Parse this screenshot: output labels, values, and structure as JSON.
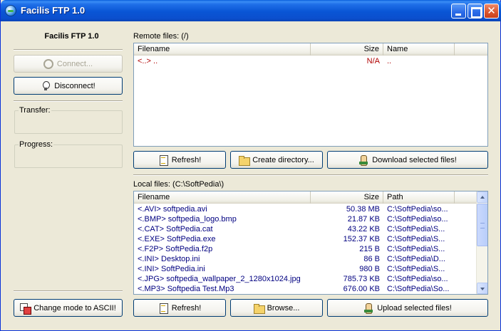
{
  "window": {
    "title": "Facilis FTP 1.0"
  },
  "sidebar": {
    "app_label": "Facilis FTP 1.0",
    "connect_label": "Connect...",
    "disconnect_label": "Disconnect!",
    "transfer_label": "Transfer:",
    "progress_label": "Progress:",
    "change_mode_label": "Change mode to ASCII!"
  },
  "remote": {
    "label": "Remote files: (/)",
    "columns": [
      "Filename",
      "Size",
      "Name"
    ],
    "rows": [
      {
        "filename": "<..> ..",
        "size": "N/A",
        "name": ".."
      }
    ],
    "refresh_label": "Refresh!",
    "create_dir_label": "Create directory...",
    "download_label": "Download selected files!"
  },
  "local": {
    "label": "Local files: (C:\\SoftPedia\\)",
    "columns": [
      "Filename",
      "Size",
      "Path"
    ],
    "rows": [
      {
        "filename": "<.AVI> softpedia.avi",
        "size": "50.38 MB",
        "path": "C:\\SoftPedia\\so..."
      },
      {
        "filename": "<.BMP> softpedia_logo.bmp",
        "size": "21.87 KB",
        "path": "C:\\SoftPedia\\so..."
      },
      {
        "filename": "<.CAT> SoftPedia.cat",
        "size": "43.22 KB",
        "path": "C:\\SoftPedia\\S..."
      },
      {
        "filename": "<.EXE> SoftPedia.exe",
        "size": "152.37 KB",
        "path": "C:\\SoftPedia\\S..."
      },
      {
        "filename": "<.F2P> SoftPedia.f2p",
        "size": "215 B",
        "path": "C:\\SoftPedia\\S..."
      },
      {
        "filename": "<.INI> Desktop.ini",
        "size": "86 B",
        "path": "C:\\SoftPedia\\D..."
      },
      {
        "filename": "<.INI> SoftPedia.ini",
        "size": "980 B",
        "path": "C:\\SoftPedia\\S..."
      },
      {
        "filename": "<.JPG> softpedia_wallpaper_2_1280x1024.jpg",
        "size": "785.73 KB",
        "path": "C:\\SoftPedia\\so..."
      },
      {
        "filename": "<.MP3> Softpedia Test.Mp3",
        "size": "676.00 KB",
        "path": "C:\\SoftPedia\\So..."
      }
    ],
    "refresh_label": "Refresh!",
    "browse_label": "Browse...",
    "upload_label": "Upload selected files!"
  }
}
